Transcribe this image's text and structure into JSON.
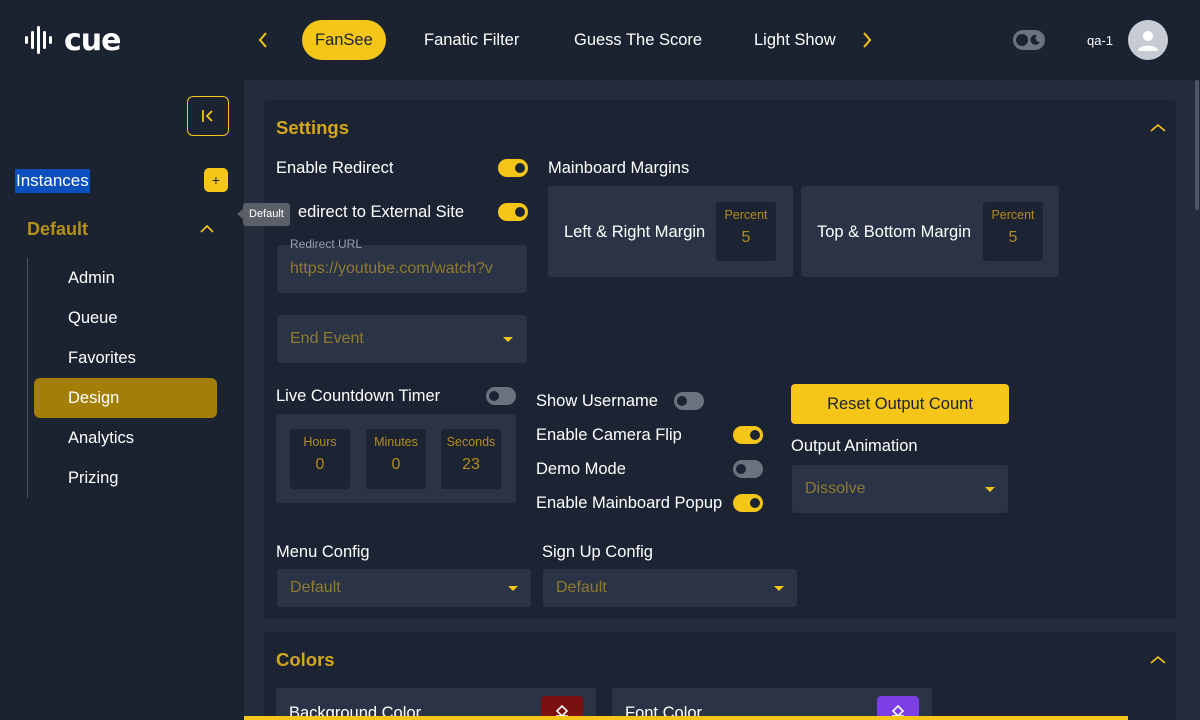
{
  "app": {
    "logo_text": "cue"
  },
  "nav": {
    "tabs": [
      {
        "label": "FanSee",
        "active": true
      },
      {
        "label": "Fanatic Filter",
        "active": false
      },
      {
        "label": "Guess The Score",
        "active": false
      },
      {
        "label": "Light Show",
        "active": false
      }
    ]
  },
  "user": {
    "name": "qa-1"
  },
  "sidebar": {
    "instances_label": "Instances",
    "add_label": "+",
    "group_label": "Default",
    "tooltip": "Default",
    "items": [
      {
        "label": "Admin",
        "active": false
      },
      {
        "label": "Queue",
        "active": false
      },
      {
        "label": "Favorites",
        "active": false
      },
      {
        "label": "Design",
        "active": true
      },
      {
        "label": "Analytics",
        "active": false
      },
      {
        "label": "Prizing",
        "active": false
      }
    ]
  },
  "settings": {
    "title": "Settings",
    "enable_redirect": {
      "label": "Enable Redirect",
      "on": true
    },
    "redirect_external": {
      "label": "Redirect to External Site",
      "visible_label": "edirect to External Site",
      "on": true
    },
    "redirect_url": {
      "caption": "Redirect URL",
      "value": "https://youtube.com/watch?v"
    },
    "end_event": {
      "value": "End Event"
    },
    "mainboard_margins": {
      "label": "Mainboard Margins",
      "left_right": {
        "label": "Left & Right Margin",
        "unit": "Percent",
        "value": "5"
      },
      "top_bottom": {
        "label": "Top & Bottom Margin",
        "unit": "Percent",
        "value": "5"
      }
    },
    "countdown": {
      "label": "Live Countdown Timer",
      "on": false,
      "hours_label": "Hours",
      "hours": "0",
      "minutes_label": "Minutes",
      "minutes": "0",
      "seconds_label": "Seconds",
      "seconds": "23"
    },
    "show_username": {
      "label": "Show Username",
      "on": false
    },
    "camera_flip": {
      "label": "Enable Camera Flip",
      "on": true
    },
    "demo_mode": {
      "label": "Demo Mode",
      "on": false
    },
    "mainboard_popup": {
      "label": "Enable Mainboard Popup",
      "on": true
    },
    "reset_button": "Reset Output Count",
    "output_animation": {
      "label": "Output Animation",
      "value": "Dissolve"
    },
    "menu_config": {
      "label": "Menu Config",
      "value": "Default"
    },
    "signup_config": {
      "label": "Sign Up Config",
      "value": "Default"
    }
  },
  "colors": {
    "title": "Colors",
    "background": {
      "label": "Background Color",
      "swatch": "#7a1010"
    },
    "font": {
      "label": "Font Color",
      "swatch": "#7b3fe4"
    }
  },
  "theme": {
    "accent": "#f5c518",
    "bg": "#1b2230",
    "panel": "#1c2433"
  }
}
